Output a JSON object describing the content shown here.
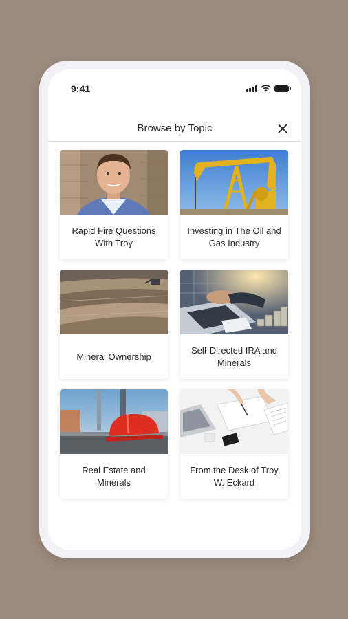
{
  "status": {
    "time": "9:41"
  },
  "header": {
    "title": "Browse by Topic"
  },
  "topics": [
    {
      "label": "Rapid Fire Questions With Troy",
      "image": "portrait-photo"
    },
    {
      "label": "Investing in The Oil and Gas Industry",
      "image": "oil-pumpjack-photo"
    },
    {
      "label": "Mineral Ownership",
      "image": "open-pit-mine-photo"
    },
    {
      "label": "Self-Directed IRA and Minerals",
      "image": "laptop-coins-photo"
    },
    {
      "label": "Real Estate and Minerals",
      "image": "hard-hat-photo"
    },
    {
      "label": "From the Desk of Troy W. Eckard",
      "image": "desk-writing-photo"
    }
  ]
}
